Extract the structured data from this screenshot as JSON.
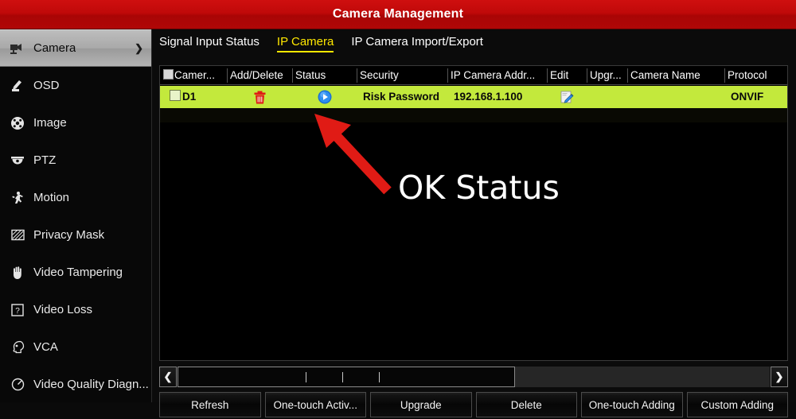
{
  "window": {
    "title": "Camera Management",
    "title_bar_color": "#c00909"
  },
  "sidebar": {
    "items": [
      {
        "label": "Camera",
        "icon": "camera-icon",
        "selected": true,
        "chevron": "❯"
      },
      {
        "label": "OSD",
        "icon": "osd-pencil-icon",
        "selected": false
      },
      {
        "label": "Image",
        "icon": "image-icon",
        "selected": false
      },
      {
        "label": "PTZ",
        "icon": "ptz-dome-icon",
        "selected": false
      },
      {
        "label": "Motion",
        "icon": "motion-person-icon",
        "selected": false
      },
      {
        "label": "Privacy Mask",
        "icon": "privacy-mask-icon",
        "selected": false
      },
      {
        "label": "Video Tampering",
        "icon": "hand-icon",
        "selected": false
      },
      {
        "label": "Video Loss",
        "icon": "question-box-icon",
        "selected": false
      },
      {
        "label": "VCA",
        "icon": "vca-head-icon",
        "selected": false
      },
      {
        "label": "Video Quality Diagn...",
        "icon": "video-quality-icon",
        "selected": false
      }
    ]
  },
  "tabs": [
    {
      "label": "Signal Input Status",
      "selected": false
    },
    {
      "label": "IP Camera",
      "selected": true
    },
    {
      "label": "IP Camera Import/Export",
      "selected": false
    }
  ],
  "table": {
    "columns": [
      {
        "label": "Camer...",
        "has_checkbox": true
      },
      {
        "label": "Add/Delete"
      },
      {
        "label": "Status"
      },
      {
        "label": "Security"
      },
      {
        "label": "IP Camera Addr..."
      },
      {
        "label": "Edit"
      },
      {
        "label": "Upgr..."
      },
      {
        "label": "Camera Name"
      },
      {
        "label": "Protocol"
      }
    ],
    "rows": [
      {
        "checked": false,
        "camera": "D1",
        "add_delete_icon": "trash-delete-icon",
        "status_icon": "play-status-icon",
        "security": "Risk Password",
        "ip_address": "192.168.1.100",
        "edit_icon": "edit-pencil-icon",
        "upgrade": "",
        "camera_name": "",
        "protocol": "ONVIF",
        "highlight_color": "#c3e93c"
      }
    ]
  },
  "scrollbar": {
    "left_arrow": "❮",
    "right_arrow": "❯"
  },
  "buttons": [
    {
      "label": "Refresh"
    },
    {
      "label": "One-touch Activ..."
    },
    {
      "label": "Upgrade"
    },
    {
      "label": "Delete"
    },
    {
      "label": "One-touch Adding"
    },
    {
      "label": "Custom Adding"
    }
  ],
  "annotation": {
    "label": "OK Status",
    "arrow_color": "#e01b15",
    "label_color": "#ffffff"
  }
}
